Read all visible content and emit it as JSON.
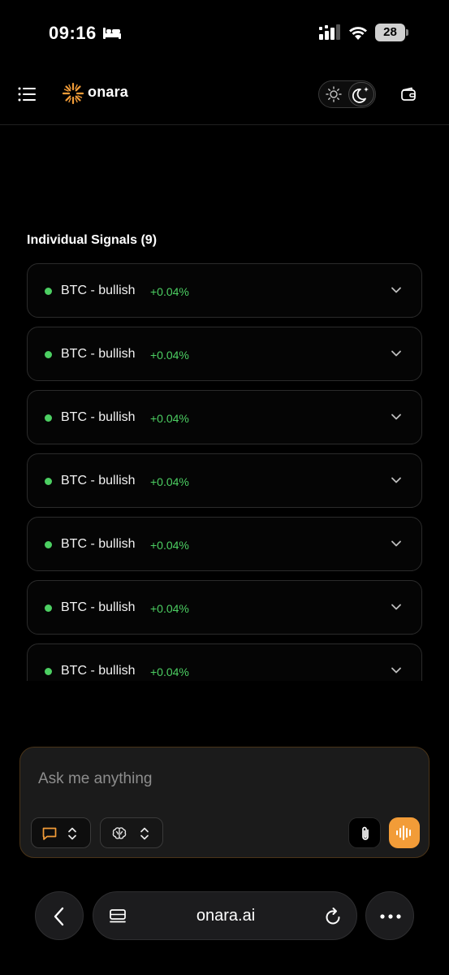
{
  "status_bar": {
    "time": "09:16",
    "battery_level": "28",
    "icons": [
      "bed-icon",
      "cellular-signal-icon",
      "wifi-icon",
      "battery-icon"
    ]
  },
  "header": {
    "brand": "onara",
    "icons": [
      "menu-icon",
      "onara-logo-icon",
      "sun-icon",
      "moon-icon",
      "wallet-icon"
    ],
    "theme_selected": "dark"
  },
  "signals": {
    "title": "Individual Signals (9)",
    "items": [
      {
        "label": "BTC - bullish",
        "change": "+0.04%"
      },
      {
        "label": "BTC - bullish",
        "change": "+0.04%"
      },
      {
        "label": "BTC - bullish",
        "change": "+0.04%"
      },
      {
        "label": "BTC - bullish",
        "change": "+0.04%"
      },
      {
        "label": "BTC - bullish",
        "change": "+0.04%"
      },
      {
        "label": "BTC - bullish",
        "change": "+0.04%"
      },
      {
        "label": "BTC - bullish",
        "change": "+0.04%"
      }
    ]
  },
  "composer": {
    "placeholder": "Ask me anything",
    "value": "",
    "icons": [
      "chat-mode-icon",
      "brain-model-icon",
      "paperclip-icon",
      "voice-waveform-icon"
    ]
  },
  "browser": {
    "url": "onara.ai",
    "icons": [
      "back-chevron-icon",
      "tabs-icon",
      "reload-icon",
      "more-dots-icon"
    ]
  },
  "colors": {
    "accent": "#f29c38",
    "positive": "#4ccf62",
    "background": "#000000"
  }
}
